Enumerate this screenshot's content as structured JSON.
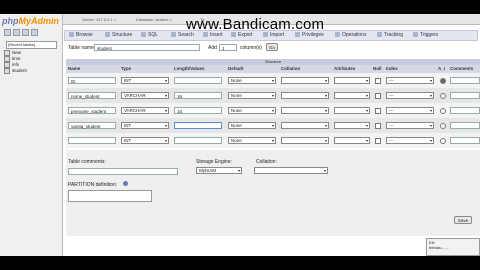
{
  "watermark": "www.Bandicam.com",
  "sidebar": {
    "logo_part1": "php",
    "logo_part2": "MyAdmin",
    "db_select": "(Recent tables) ...",
    "tree": [
      "New",
      "time",
      "info",
      "student"
    ]
  },
  "browser_tabs": [
    "Server: 127.0.0.1 »",
    "Database: student »",
    "Ta"
  ],
  "menu": [
    "Browse",
    "Structure",
    "SQL",
    "Search",
    "Insert",
    "Export",
    "Import",
    "Privileges",
    "Operations",
    "Tracking",
    "Triggers"
  ],
  "table_form": {
    "table_name_label": "Table name:",
    "table_name_value": "student",
    "add_label": "Add",
    "add_value": "1",
    "columns_label": "column(s)",
    "go_label": "Go"
  },
  "structure_label": "Structure",
  "columns_header": [
    "Name",
    "Type",
    "Length/Values",
    "Default",
    "Collation",
    "Attributes",
    "Null",
    "Index",
    "A_I",
    "Comments"
  ],
  "rows": [
    {
      "name": "ID",
      "type": "INT",
      "length": "",
      "default": "None",
      "collation": "",
      "attributes": "",
      "index": "---",
      "ai": true
    },
    {
      "name": "nome_student",
      "type": "VARCHAR",
      "length": "16",
      "default": "None",
      "collation": "",
      "attributes": "",
      "index": "---",
      "ai": false
    },
    {
      "name": "prenume_student",
      "type": "VARCHAR",
      "length": "16",
      "default": "None",
      "collation": "",
      "attributes": "",
      "index": "---",
      "ai": false
    },
    {
      "name": "varsta_student",
      "type": "INT",
      "length": "",
      "default": "None",
      "collation": "",
      "attributes": "",
      "index": "---",
      "ai": false
    },
    {
      "name": "",
      "type": "INT",
      "length": "",
      "default": "None",
      "collation": "",
      "attributes": "",
      "index": "---",
      "ai": false
    }
  ],
  "bottom": {
    "table_comments_label": "Table comments:",
    "storage_engine_label": "Storage Engine:",
    "storage_engine_value": "MyISAM",
    "collation_label": "Collation:",
    "partition_label": "PARTITION definition:",
    "save_label": "Save"
  },
  "notification": {
    "line1": "EN",
    "line2": "Introdu... ..."
  }
}
